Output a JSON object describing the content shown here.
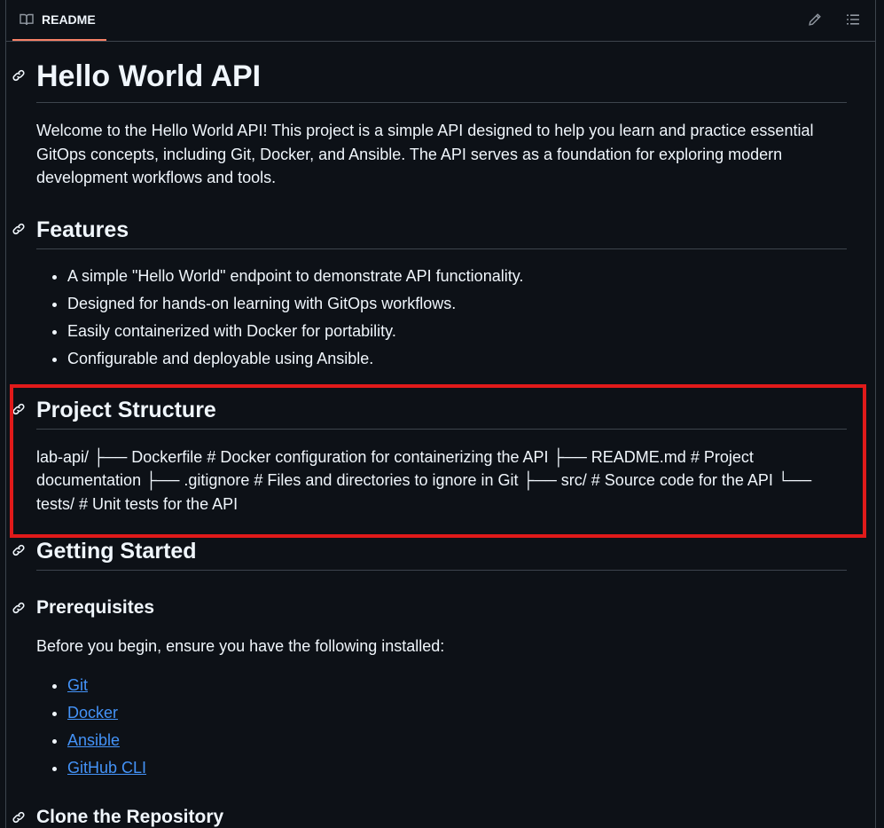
{
  "header": {
    "tab_label": "README",
    "edit_icon": "pencil-icon",
    "outline_icon": "list-unordered-icon",
    "accent": "#f78166"
  },
  "readme": {
    "title": "Hello World API",
    "intro": "Welcome to the Hello World API! This project is a simple API designed to help you learn and practice essential GitOps concepts, including Git, Docker, and Ansible. The API serves as a foundation for exploring modern development workflows and tools.",
    "features": {
      "heading": "Features",
      "items": [
        "A simple \"Hello World\" endpoint to demonstrate API functionality.",
        "Designed for hands-on learning with GitOps workflows.",
        "Easily containerized with Docker for portability.",
        "Configurable and deployable using Ansible."
      ]
    },
    "structure": {
      "heading": "Project Structure",
      "text": "lab-api/ ├── Dockerfile # Docker configuration for containerizing the API ├── README.md # Project documentation ├── .gitignore # Files and directories to ignore in Git ├── src/ # Source code for the API └── tests/ # Unit tests for the API"
    },
    "getting_started": {
      "heading": "Getting Started"
    },
    "prerequisites": {
      "heading": "Prerequisites",
      "intro": "Before you begin, ensure you have the following installed:",
      "links": [
        "Git",
        "Docker",
        "Ansible",
        "GitHub CLI"
      ]
    },
    "clone": {
      "heading": "Clone the Repository"
    }
  },
  "colors": {
    "background": "#0d1117",
    "text": "#f0f6fc",
    "link": "#4493f8",
    "border": "#3d444d",
    "highlight": "#e01a1a"
  }
}
